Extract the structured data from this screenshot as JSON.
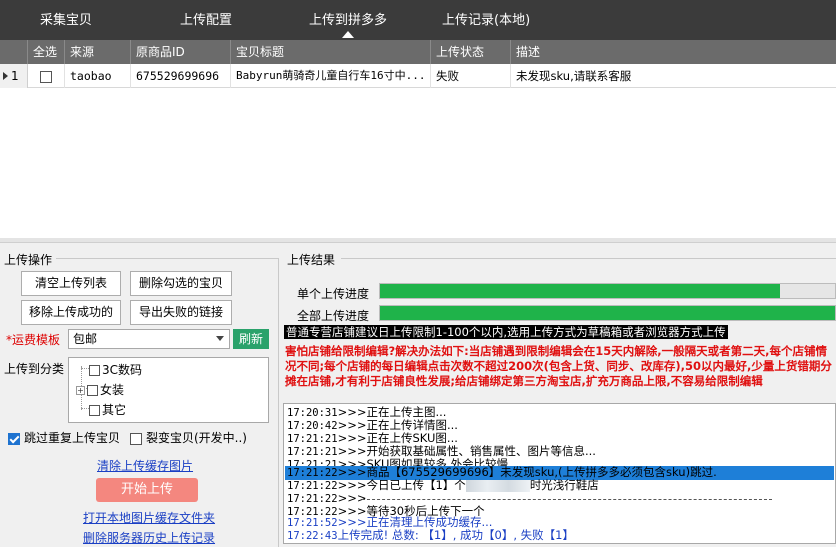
{
  "nav": {
    "tabs": [
      {
        "label": "采集宝贝"
      },
      {
        "label": "上传配置"
      },
      {
        "label": "上传到拼多多"
      },
      {
        "label": "上传记录(本地)"
      }
    ],
    "active": "上传到拼多多"
  },
  "table": {
    "columns": [
      "全选",
      "来源",
      "原商品ID",
      "宝贝标题",
      "上传状态",
      "描述"
    ],
    "rows": [
      {
        "index": "1",
        "checked": false,
        "source": "taobao",
        "item_id": "675529699696",
        "title": "Babyrun萌骑奇儿童自行车16寸中...",
        "status": "失败",
        "description": "未发现sku,请联系客服"
      }
    ]
  },
  "ops": {
    "title": "上传操作",
    "buttons": {
      "clear_list": "清空上传列表",
      "delete_checked": "删除勾选的宝贝",
      "remove_success": "移除上传成功的",
      "export_failed": "导出失败的链接"
    },
    "shipping_label": "运费模板",
    "shipping_value": "包邮",
    "refresh_label": "刷新",
    "category_label": "上传到分类",
    "categories": [
      {
        "label": "3C数码"
      },
      {
        "label": "女装"
      },
      {
        "label": "其它"
      }
    ],
    "skip_duplicate": {
      "label": "跳过重复上传宝贝",
      "checked": true
    },
    "split_item": {
      "label": "裂变宝贝(开发中..)",
      "checked": false
    },
    "clear_cache_link": "清除上传缓存图片",
    "start_button": "开始上传",
    "open_cache_link": "打开本地图片缓存文件夹",
    "delete_history_link": "删除服务器历史上传记录"
  },
  "results": {
    "title": "上传结果",
    "single_label": "单个上传进度",
    "single_progress": 0.88,
    "all_label": "全部上传进度",
    "all_progress": 1.0,
    "black_note": "普通专营店铺建议日上传限制1-100个以内,选用上传方式为草稿箱或者浏览器方式上传",
    "red_note": "害怕店铺给限制编辑?解决办法如下:当店铺遇到限制编辑会在15天内解除,一般隔天或者第二天,每个店铺情况不同;每个店铺的每日编辑点击次数不超过200次(包含上货、同步、改库存),50以内最好,少量上货错期分摊在店铺,才有利于店铺良性发展;给店铺绑定第三方淘宝店,扩充万商品上限,不容易给限制编辑",
    "log": [
      {
        "ts": "17:20:31",
        "text": ">>>正在上传主图...",
        "style": "normal"
      },
      {
        "ts": "17:20:42",
        "text": ">>>正在上传详情图...",
        "style": "normal"
      },
      {
        "ts": "17:21:21",
        "text": ">>>正在上传SKU图...",
        "style": "normal"
      },
      {
        "ts": "17:21:21",
        "text": ">>>开始获取基础属性、销售属性、图片等信息...",
        "style": "normal"
      },
      {
        "ts": "17:21:21",
        "text": ">>>SKU图如果较多,外会比较慢",
        "style": "normal"
      },
      {
        "ts": "17:21:22",
        "text": ">>>商品【675529699696】未发现sku,(上传拼多多必须包含sku)跳过.",
        "style": "hl"
      },
      {
        "ts": "17:21:22",
        "text": ">>>今日已上传【1】个",
        "suffix": "时光浅行鞋店",
        "style": "normal"
      },
      {
        "ts": "17:21:22",
        "text": ">>>",
        "style": "divider"
      },
      {
        "ts": "17:21:22",
        "text": ">>>等待30秒后上传下一个",
        "style": "normal"
      },
      {
        "ts": "17:21:52",
        "text": ">>>正在清理上传成功缓存...",
        "style": "blue"
      },
      {
        "ts": "17:22:43",
        "text": "上传完成! 总数: 【1】, 成功【0】, 失败【1】",
        "style": "blue"
      }
    ]
  }
}
